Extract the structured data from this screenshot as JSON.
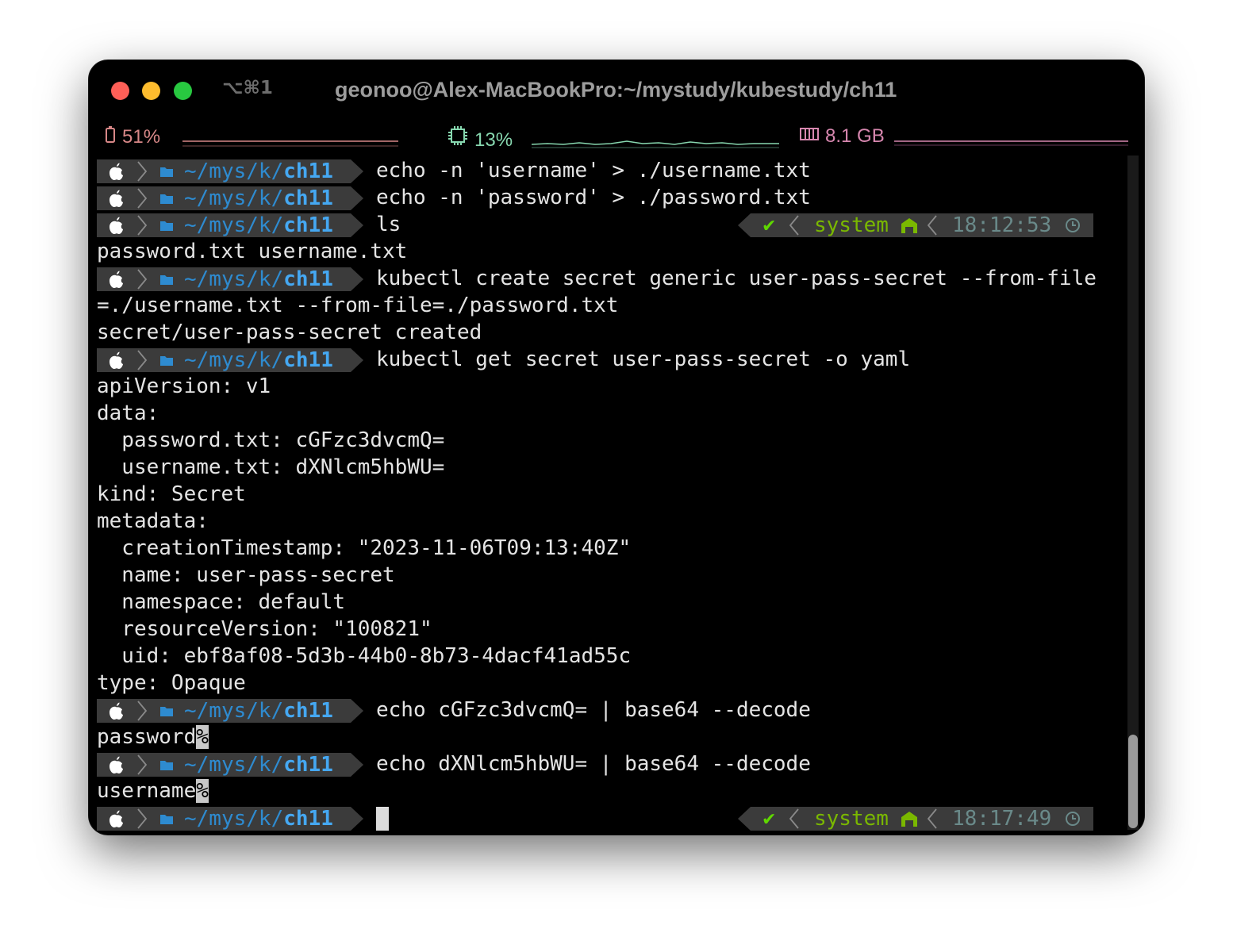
{
  "window": {
    "title": "geonoo@Alex-MacBookPro:~/mystudy/kubestudy/ch11",
    "shortcut": "⌥⌘1"
  },
  "status": {
    "battery": "51%",
    "cpu": "13%",
    "memory": "8.1 GB"
  },
  "prompt": {
    "path_dim": "~/mys/k/",
    "path_dir": "ch11"
  },
  "rprompt": {
    "env": "system"
  },
  "lines": [
    {
      "kind": "prompt",
      "cmd": "echo -n 'username' > ./username.txt"
    },
    {
      "kind": "prompt",
      "cmd": "echo -n 'password' > ./password.txt"
    },
    {
      "kind": "prompt",
      "cmd": "ls",
      "time": "18:12:53"
    },
    {
      "kind": "out",
      "text": "password.txt username.txt"
    },
    {
      "kind": "prompt",
      "cmd": "kubectl create secret generic user-pass-secret --from-file"
    },
    {
      "kind": "out",
      "text": "=./username.txt --from-file=./password.txt"
    },
    {
      "kind": "out",
      "text": "secret/user-pass-secret created"
    },
    {
      "kind": "prompt",
      "cmd": "kubectl get secret user-pass-secret -o yaml"
    },
    {
      "kind": "out",
      "text": "apiVersion: v1"
    },
    {
      "kind": "out",
      "text": "data:"
    },
    {
      "kind": "out",
      "text": "  password.txt: cGFzc3dvcmQ="
    },
    {
      "kind": "out",
      "text": "  username.txt: dXNlcm5hbWU="
    },
    {
      "kind": "out",
      "text": "kind: Secret"
    },
    {
      "kind": "out",
      "text": "metadata:"
    },
    {
      "kind": "out",
      "text": "  creationTimestamp: \"2023-11-06T09:13:40Z\""
    },
    {
      "kind": "out",
      "text": "  name: user-pass-secret"
    },
    {
      "kind": "out",
      "text": "  namespace: default"
    },
    {
      "kind": "out",
      "text": "  resourceVersion: \"100821\""
    },
    {
      "kind": "out",
      "text": "  uid: ebf8af08-5d3b-44b0-8b73-4dacf41ad55c"
    },
    {
      "kind": "out",
      "text": "type: Opaque"
    },
    {
      "kind": "prompt",
      "cmd": "echo cGFzc3dvcmQ= | base64 --decode"
    },
    {
      "kind": "out",
      "text": "password",
      "mark": "%"
    },
    {
      "kind": "prompt",
      "cmd": "echo dXNlcm5hbWU= | base64 --decode"
    },
    {
      "kind": "out",
      "text": "username",
      "mark": "%"
    },
    {
      "kind": "prompt",
      "cmd": "",
      "cursor": true,
      "time": "18:17:49"
    }
  ],
  "colors": {
    "prompt_bg": "#3b3b3b",
    "path_dim": "#2e8bd0",
    "path_dir": "#45a8f2",
    "ok_green": "#5fd700",
    "env_green": "#7ab800",
    "time": "#6a8a8a",
    "battery": "#d78787",
    "cpu": "#87d7af",
    "mem": "#d787af"
  }
}
